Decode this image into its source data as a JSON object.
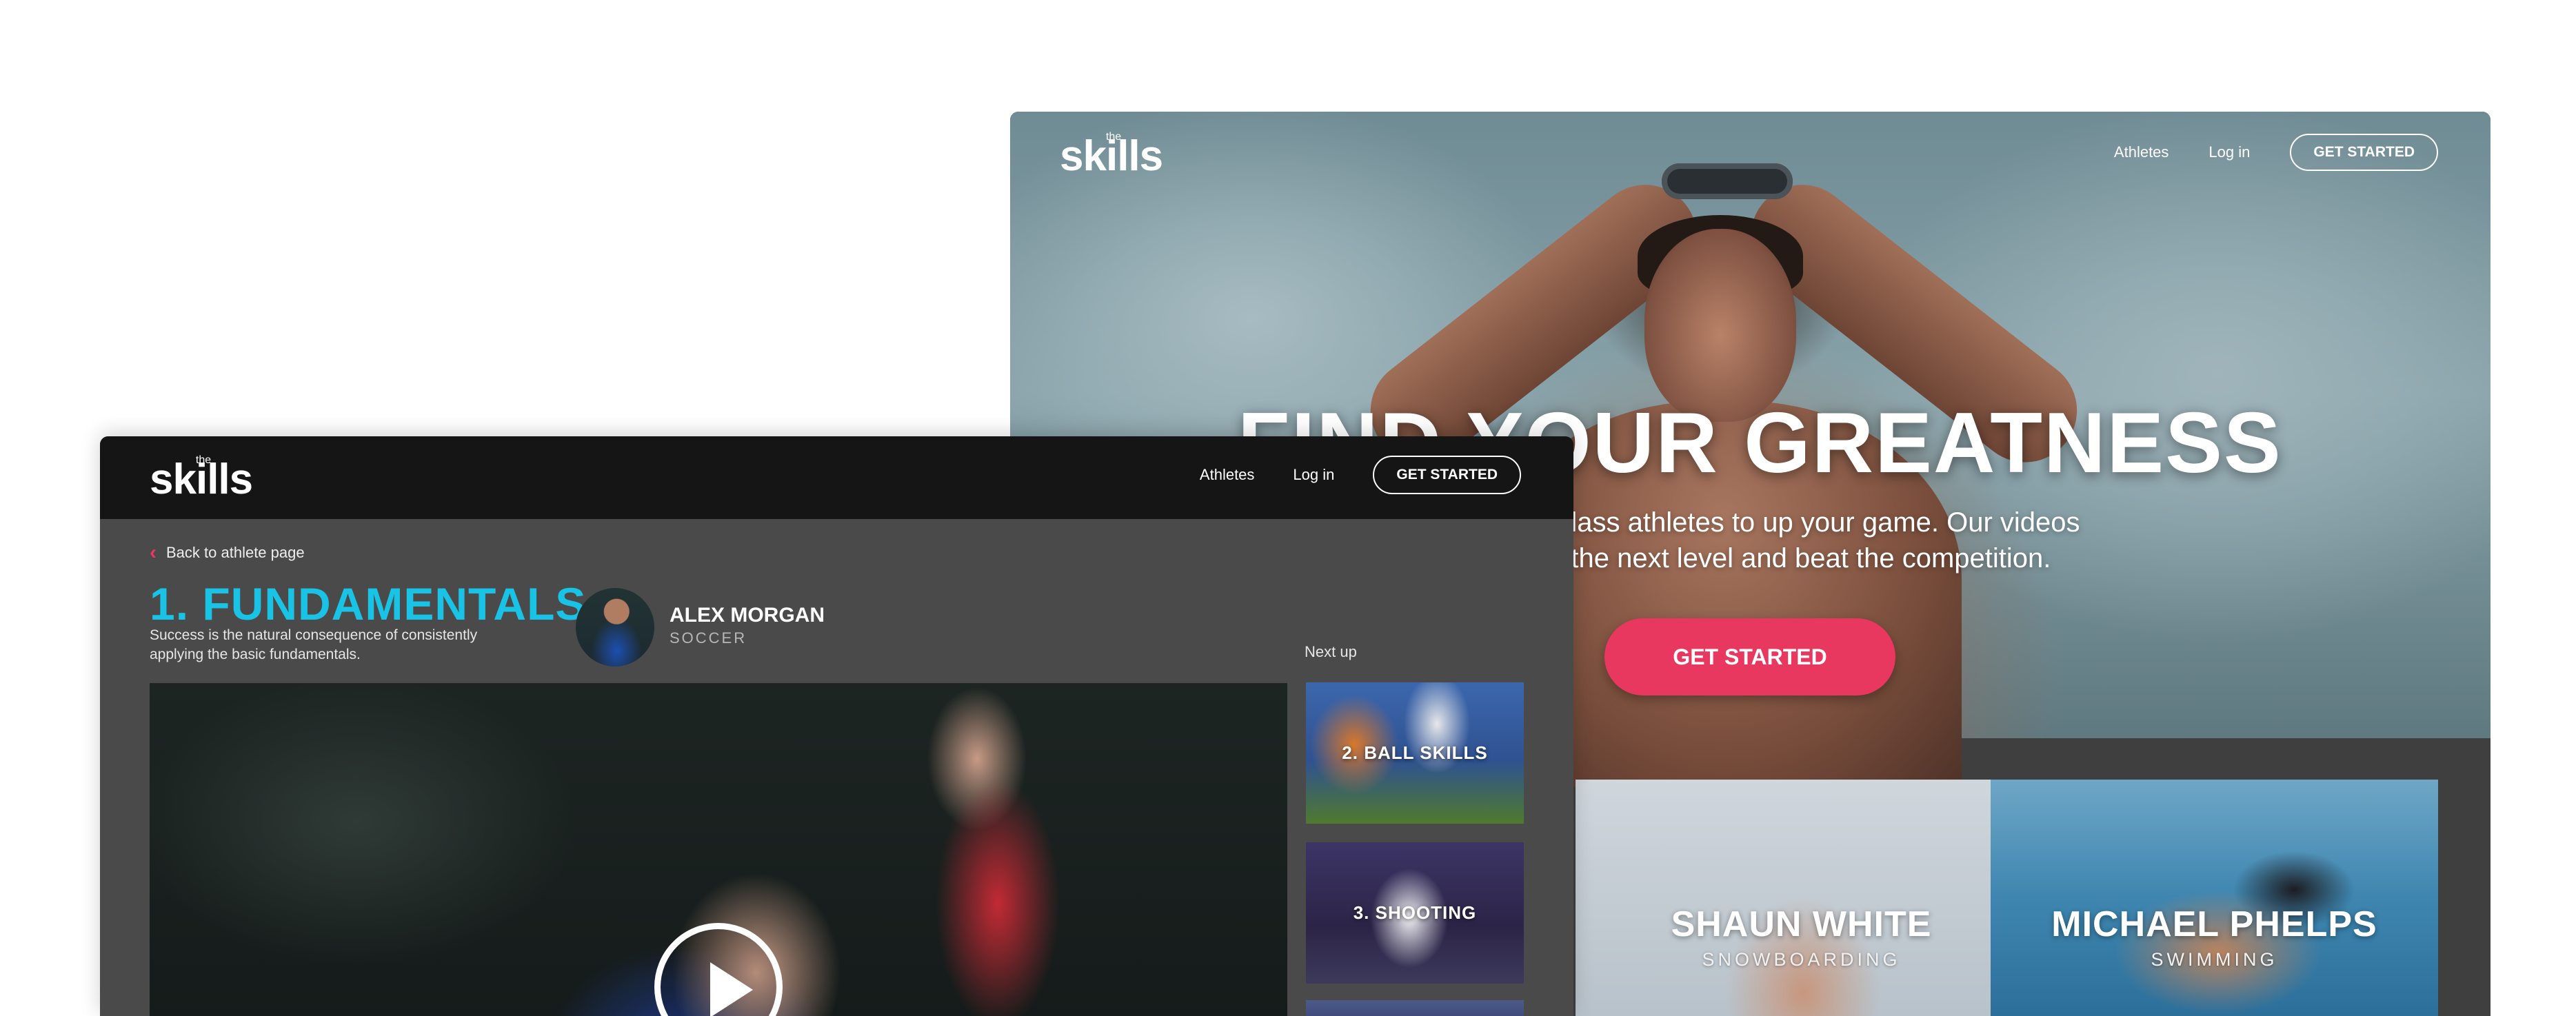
{
  "landing": {
    "logo": {
      "small": "the",
      "word": "skills"
    },
    "nav": {
      "athletes": "Athletes",
      "login": "Log in",
      "cta": "GET STARTED"
    },
    "hero": {
      "title": "FIND YOUR GREATNESS",
      "subtitle_line1": "d class athletes to up your game. Our videos",
      "subtitle_line2": "ch the next level and beat the competition.",
      "cta": "GET STARTED"
    },
    "athletes": [
      {
        "name": "SHAUN WHITE",
        "sport": "SNOWBOARDING"
      },
      {
        "name": "MICHAEL PHELPS",
        "sport": "SWIMMING"
      }
    ]
  },
  "lesson": {
    "logo": {
      "small": "the",
      "word": "skills"
    },
    "nav": {
      "athletes": "Athletes",
      "login": "Log in",
      "cta": "GET STARTED"
    },
    "back_link": "Back to athlete page",
    "title": "1. FUNDAMENTALS",
    "description": "Success is the natural consequence of consistently applying the basic fundamentals.",
    "coach": {
      "name": "ALEX MORGAN",
      "sport": "SOCCER"
    },
    "next_up_label": "Next up",
    "next_up": [
      {
        "label": "2. BALL SKILLS"
      },
      {
        "label": "3. SHOOTING"
      }
    ]
  },
  "colors": {
    "accent_pink": "#e8385f",
    "accent_cyan": "#19c3e6",
    "header_dark": "#151515",
    "body_gray": "#4a4a4a"
  }
}
